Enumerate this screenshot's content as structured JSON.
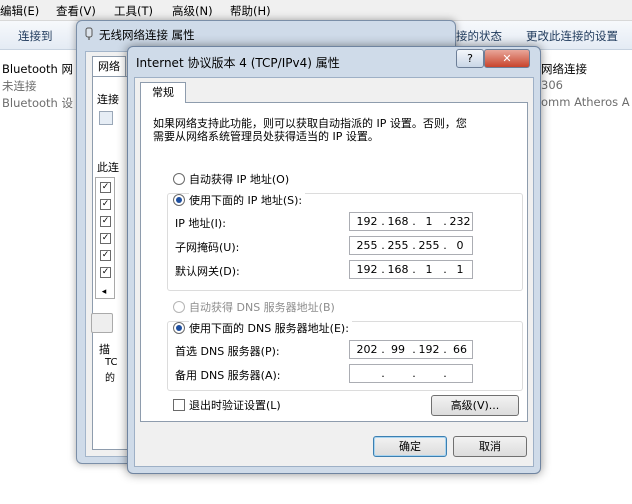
{
  "menubar": {
    "items": [
      "编辑(E)",
      "查看(V)",
      "工具(T)",
      "高级(N)",
      "帮助(H)"
    ]
  },
  "cmdbar": {
    "connect_to": "连接到",
    "status_partial": "接的状态",
    "change_settings": "更改此连接的设置"
  },
  "background_connections": {
    "left_name": "Bluetooth 网",
    "left_status": "未连接",
    "left_device": "Bluetooth 设",
    "right_name": "网络连接",
    "right_status": "306",
    "right_device": "omm Atheros A"
  },
  "wireless_dialog": {
    "title": "无线网络连接 属性",
    "tab": "网络",
    "connect_using_partial": "连接",
    "items_partial": "此连",
    "describe_partial": "描",
    "desc_line1": "TC",
    "desc_line2": "的"
  },
  "ipv4_dialog": {
    "title": "Internet 协议版本 4 (TCP/IPv4) 属性",
    "help_glyph": "?",
    "close_glyph": "✕",
    "tab_general": "常规",
    "description_line1": "如果网络支持此功能，则可以获取自动指派的 IP 设置。否则，您",
    "description_line2": "需要从网络系统管理员处获得适当的 IP 设置。",
    "auto_ip_label": "自动获得 IP 地址(O)",
    "manual_ip_label": "使用下面的 IP 地址(S):",
    "ip_address_label": "IP 地址(I):",
    "ip_address": [
      "192",
      "168",
      "1",
      "232"
    ],
    "subnet_mask_label": "子网掩码(U):",
    "subnet_mask": [
      "255",
      "255",
      "255",
      "0"
    ],
    "gateway_label": "默认网关(D):",
    "gateway": [
      "192",
      "168",
      "1",
      "1"
    ],
    "auto_dns_label": "自动获得 DNS 服务器地址(B)",
    "manual_dns_label": "使用下面的 DNS 服务器地址(E):",
    "preferred_dns_label": "首选 DNS 服务器(P):",
    "preferred_dns": [
      "202",
      "99",
      "192",
      "66"
    ],
    "alternate_dns_label": "备用 DNS 服务器(A):",
    "alternate_dns": [
      "",
      "",
      "",
      ""
    ],
    "validate_on_exit_label": "退出时验证设置(L)",
    "advanced_button": "高级(V)...",
    "ok_button": "确定",
    "cancel_button": "取消",
    "dot": "."
  }
}
